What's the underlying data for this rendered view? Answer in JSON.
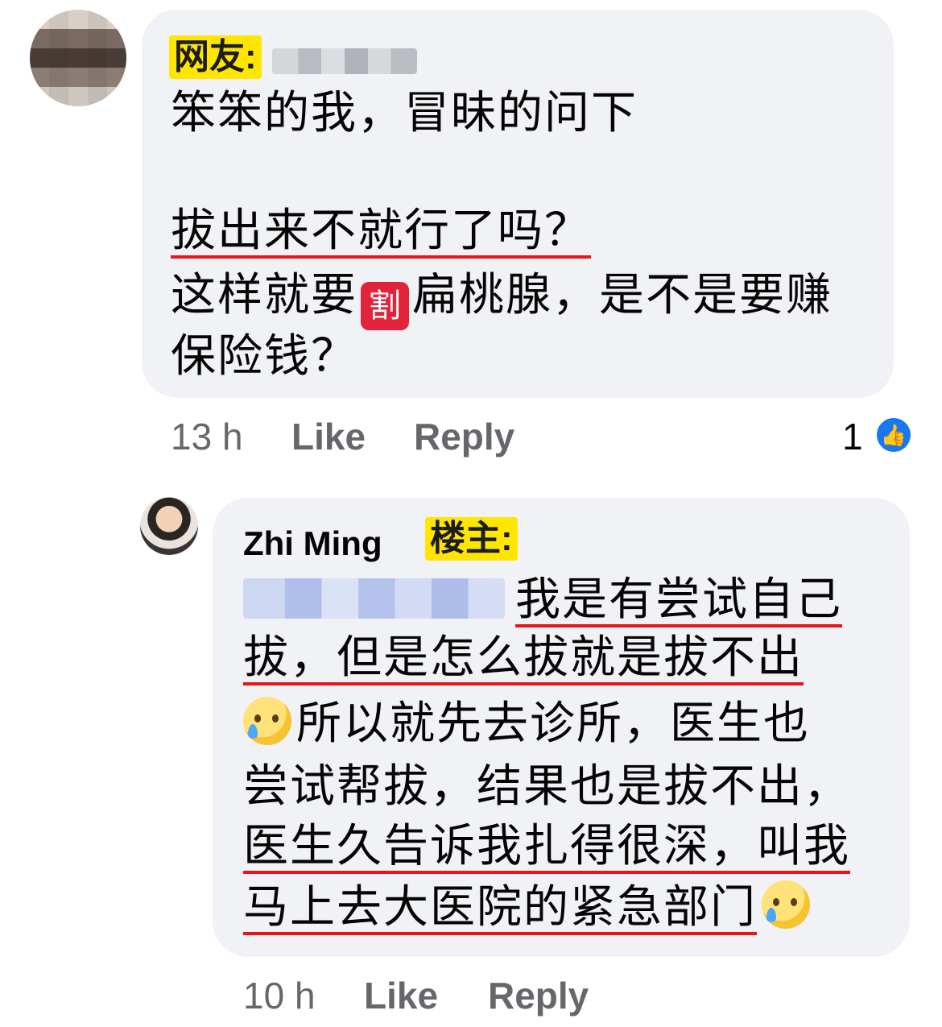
{
  "comment1": {
    "tag": "网友:",
    "lines": [
      "笨笨的我，冒昧的问下",
      "拔出来不就行了吗？",
      "这样就要",
      "扁桃腺，是不是要赚",
      "保险钱？"
    ],
    "emoji": "割",
    "time": "13 h",
    "like_label": "Like",
    "reply_label": "Reply",
    "reaction_count": "1",
    "reaction_icon": "thumbs-up-icon"
  },
  "comment2": {
    "author": "Zhi Ming",
    "tag": "楼主:",
    "lines": [
      "我是有尝试自己",
      "拔，但是怎么拔就是拔不出",
      "所以就先去诊所，医生也",
      "尝试帮拔，结果也是拔不出，",
      "医生久告诉我扎得很深，叫我",
      "马上去大医院的紧急部门"
    ],
    "time": "10 h",
    "like_label": "Like",
    "reply_label": "Reply"
  },
  "colors": {
    "bubble": "#f0f2f5",
    "highlight": "#ffe600",
    "underline": "#e8141a",
    "meta": "#65676b",
    "like_blue": "#1877f2"
  }
}
